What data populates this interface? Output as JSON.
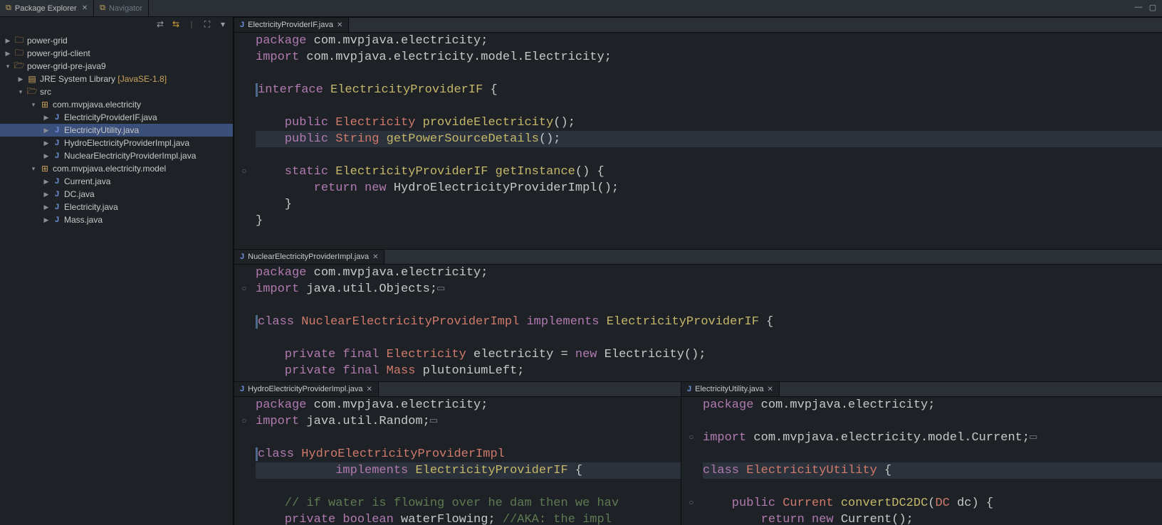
{
  "view_tabs": {
    "package_explorer": "Package Explorer",
    "navigator": "Navigator"
  },
  "tree": {
    "projects": [
      {
        "label": "power-grid"
      },
      {
        "label": "power-grid-client"
      },
      {
        "label": "power-grid-pre-java9"
      }
    ],
    "jre": {
      "label": "JRE System Library",
      "version_suffix": " [JavaSE-1.8]"
    },
    "src_label": "src",
    "pkg1": "com.mvpjava.electricity",
    "pkg1_files": [
      "ElectricityProviderIF.java",
      "ElectricityUtility.java",
      "HydroElectricityProviderImpl.java",
      "NuclearElectricityProviderImpl.java"
    ],
    "pkg2": "com.mvpjava.electricity.model",
    "pkg2_files": [
      "Current.java",
      "DC.java",
      "Electricity.java",
      "Mass.java"
    ]
  },
  "editor1": {
    "tab": "ElectricityProviderIF.java",
    "l1a": "package",
    "l1b": " com.mvpjava.electricity;",
    "l2a": "import",
    "l2b": " com.mvpjava.electricity.model.Electricity;",
    "l4a": "interface",
    "l4b": " ElectricityProviderIF",
    "l4c": " {",
    "l6a": "    public",
    "l6b": " Electricity",
    "l6c": " provideElectricity",
    "l6d": "();",
    "l7a": "    public",
    "l7b": " String",
    "l7c": " getPowerSourceDetails",
    "l7d": "();",
    "l9a": "    static",
    "l9b": " ElectricityProviderIF",
    "l9c": " getInstance",
    "l9d": "() {",
    "l10a": "        return",
    "l10b": " new",
    "l10c": " HydroElectricityProviderImpl();",
    "l11": "    }",
    "l12": "}"
  },
  "editor2": {
    "tab": "NuclearElectricityProviderImpl.java",
    "l1a": "package",
    "l1b": " com.mvpjava.electricity;",
    "l2a": "import",
    "l2b": " java.util.Objects;",
    "l4a": "class",
    "l4b": " NuclearElectricityProviderImpl",
    "l4c": " implements",
    "l4d": " ElectricityProviderIF",
    "l4e": " {",
    "l6a": "    private",
    "l6b": " final",
    "l6c": " Electricity",
    "l6d": " electricity = ",
    "l6e": "new",
    "l6f": " Electricity();",
    "l7a": "    private",
    "l7b": " final",
    "l7c": " Mass",
    "l7d": " plutoniumLeft;"
  },
  "editor3": {
    "tab": "HydroElectricityProviderImpl.java",
    "l1a": "package",
    "l1b": " com.mvpjava.electricity;",
    "l2a": "import",
    "l2b": " java.util.Random;",
    "l4a": "class",
    "l4b": " HydroElectricityProviderImpl",
    "l5a": "           implements",
    "l5b": " ElectricityProviderIF",
    "l5c": " {",
    "l7": "    // if water is flowing over he dam then we hav",
    "l8a": "    private",
    "l8b": " boolean",
    "l8c": " waterFlowing; ",
    "l8d": "//AKA: the impl"
  },
  "editor4": {
    "tab": "ElectricityUtility.java",
    "l1a": "package",
    "l1b": " com.mvpjava.electricity;",
    "l3a": "import",
    "l3b": " com.mvpjava.electricity.model.Current;",
    "l5a": "class",
    "l5b": " ElectricityUtility",
    "l5c": " {",
    "l7a": "    public",
    "l7b": " Current",
    "l7c": " convertDC2DC",
    "l7d": "(",
    "l7e": "DC",
    "l7f": " dc) {",
    "l8a": "        return",
    "l8b": " new",
    "l8c": " Current();"
  }
}
